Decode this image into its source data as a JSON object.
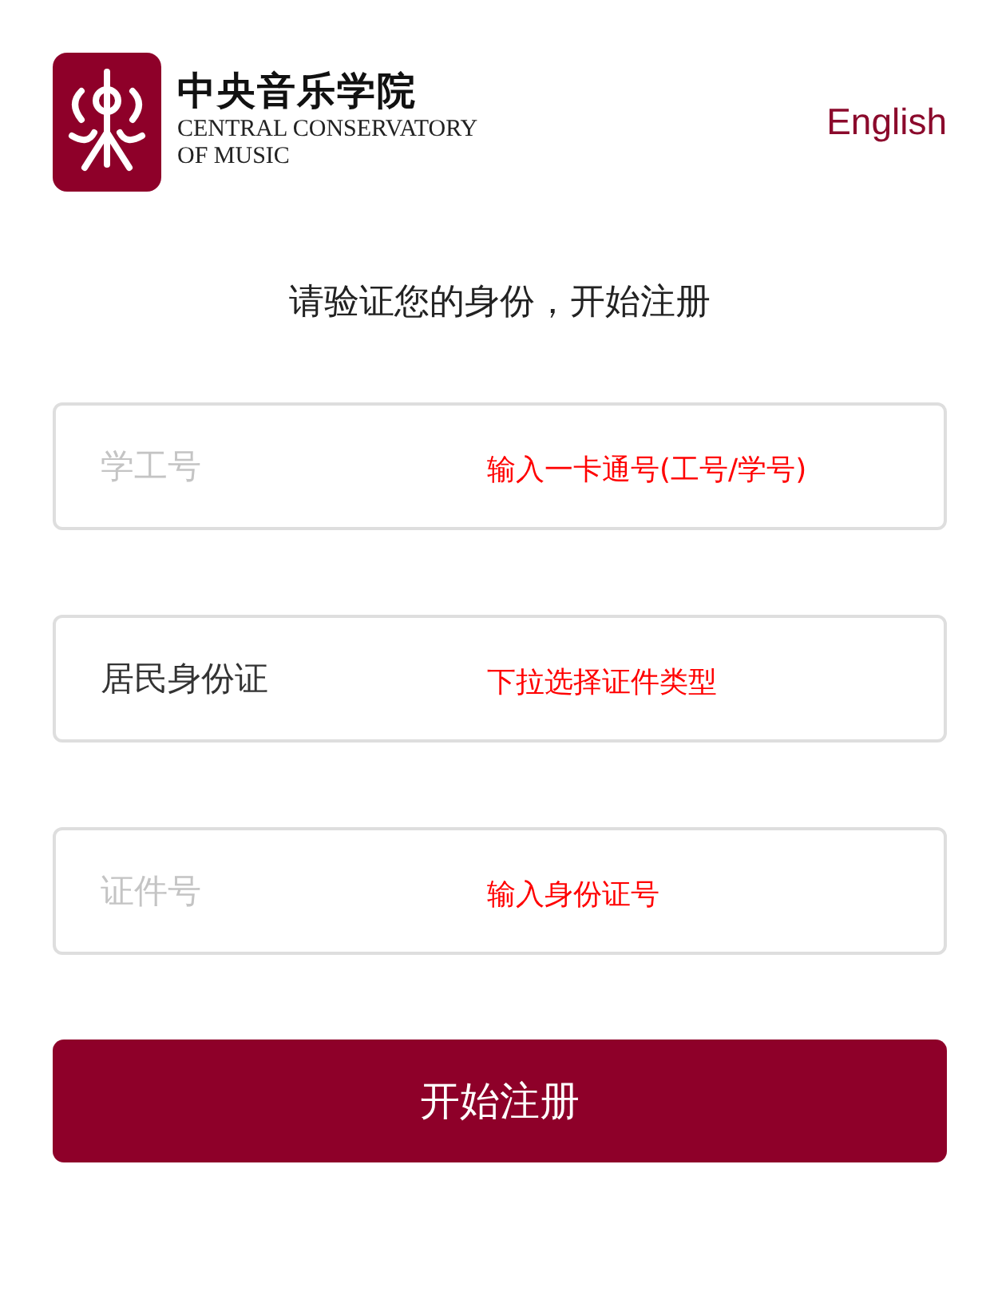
{
  "header": {
    "name_zh": "中央音乐学院",
    "name_en_1": "CENTRAL CONSERVATORY",
    "name_en_2": "OF MUSIC",
    "language_link": "English"
  },
  "heading": "请验证您的身份，开始注册",
  "fields": [
    {
      "kind": "input",
      "placeholder": "学工号",
      "annotation": "输入一卡通号(工号/学号)"
    },
    {
      "kind": "select",
      "value": "居民身份证",
      "annotation": "下拉选择证件类型"
    },
    {
      "kind": "input",
      "placeholder": "证件号",
      "annotation": "输入身份证号"
    }
  ],
  "submit_button": "开始注册"
}
